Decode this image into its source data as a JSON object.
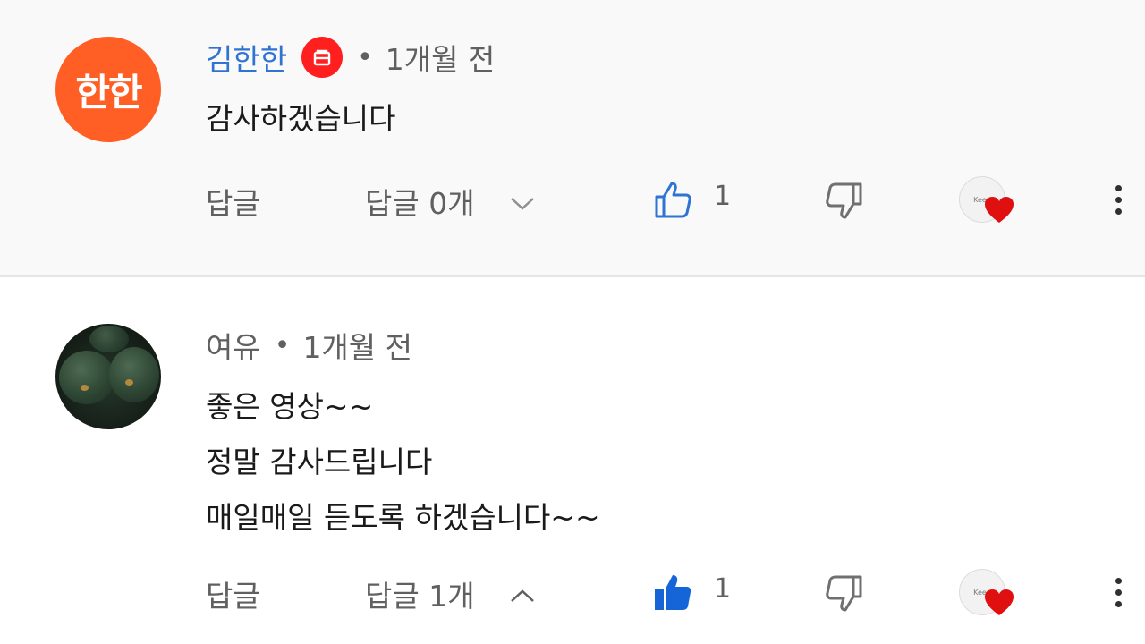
{
  "comments": [
    {
      "avatar_text": "한한",
      "author": "김한한",
      "time": "1개월 전",
      "text": "감사하겠습니다",
      "reply_label": "답글",
      "replies_label": "답글 0개",
      "like_count": "1",
      "heart_avatar_text": "Keep",
      "colors": {
        "author": "#2f73d3",
        "avatar_bg": "#ff5e24",
        "badge": "#ff1f1f"
      }
    },
    {
      "author": "여유",
      "time": "1개월 전",
      "text_lines": [
        "좋은 영상~~",
        "정말 감사드립니다",
        "매일매일 듣도록 하겠습니다~~"
      ],
      "reply_label": "답글",
      "replies_label": "답글 1개",
      "like_count": "1",
      "heart_avatar_text": "Keep",
      "colors": {
        "like_active": "#1565d8"
      }
    }
  ],
  "separator": "•",
  "icons": {
    "creator_badge": "creator-badge-icon",
    "like": "thumbs-up-icon",
    "dislike": "thumbs-down-icon",
    "heart": "creator-heart-icon",
    "more": "more-vert-icon",
    "expand": "chevron-down-icon",
    "collapse": "chevron-up-icon"
  }
}
